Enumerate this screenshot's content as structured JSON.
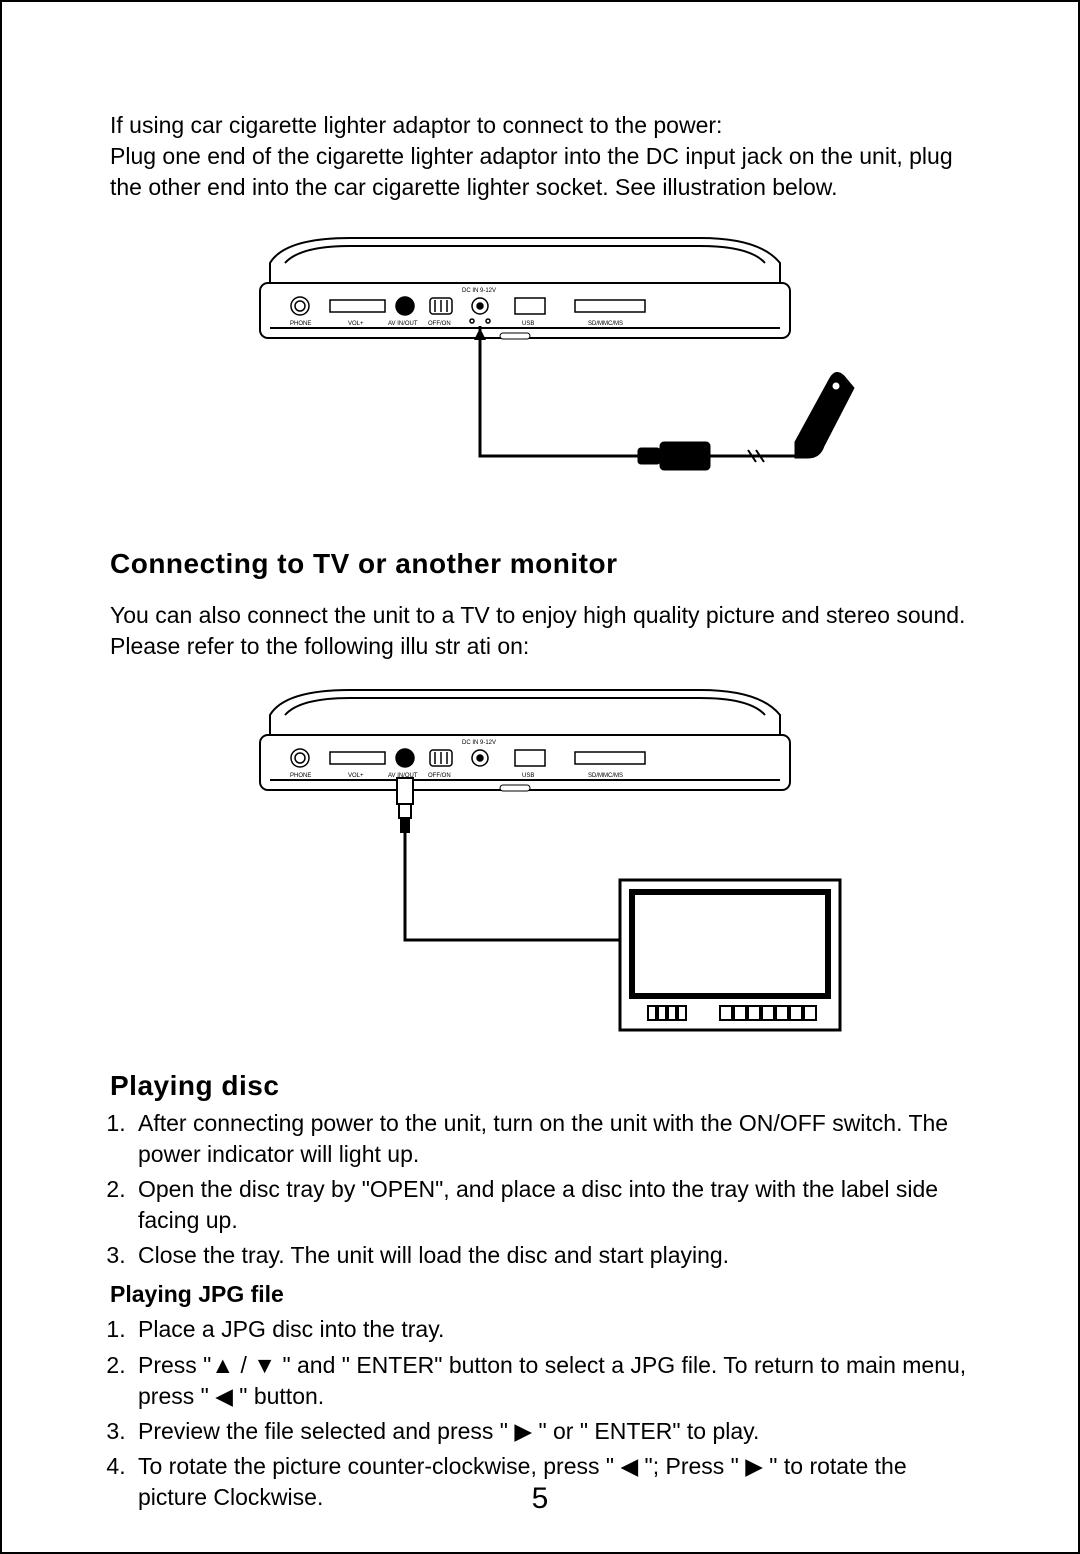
{
  "intro": {
    "line1": "If using car cigarette lighter adaptor to connect to the power:",
    "line2": "Plug one end of the cigarette lighter adaptor into the DC input jack on the unit, plug the other end into the car cigarette lighter socket. See illustration below."
  },
  "device_labels": {
    "phone": "PHONE",
    "vol": "VOL+",
    "av": "AV IN/OUT",
    "offon": "OFF/ON",
    "dc": "DC IN 9-12V",
    "usb": "USB",
    "sd": "SD/MMC/MS"
  },
  "section_tv": {
    "heading": "Connecting to TV or another monitor",
    "para": "You can also connect the unit to a TV to enjoy high quality picture and stereo sound. Please refer to the following  illu str ati on:"
  },
  "section_play": {
    "heading": "Playing disc",
    "steps": [
      "After connecting power to the unit, turn on the unit with the ON/OFF switch. The power indicator will light up.",
      "Open the disc tray by \"OPEN\", and place a disc into the tray with the label side facing up.",
      "Close the tray. The unit will load the disc and start playing."
    ],
    "jpg_heading": "Playing JPG file",
    "jpg_steps": {
      "s1": "Place a JPG disc into the tray.",
      "s2a": "Press \"",
      "s2b": " / ",
      "s2c": " \" and \" ENTER\"  button to select a JPG file. To return to main menu, press \" ",
      "s2d": " \" button.",
      "s3a": "Preview the file selected and press \" ",
      "s3b": " \"   or \" ENTER\" to play.",
      "s4a": "To rotate the picture counter-clockwise, press \" ",
      "s4b": " \"; Press  \" ",
      "s4c": " \"  to rotate the picture Clockwise."
    }
  },
  "glyphs": {
    "up": "▲",
    "down": "▼",
    "left": "◀",
    "right": "▶"
  },
  "page_number": "5"
}
